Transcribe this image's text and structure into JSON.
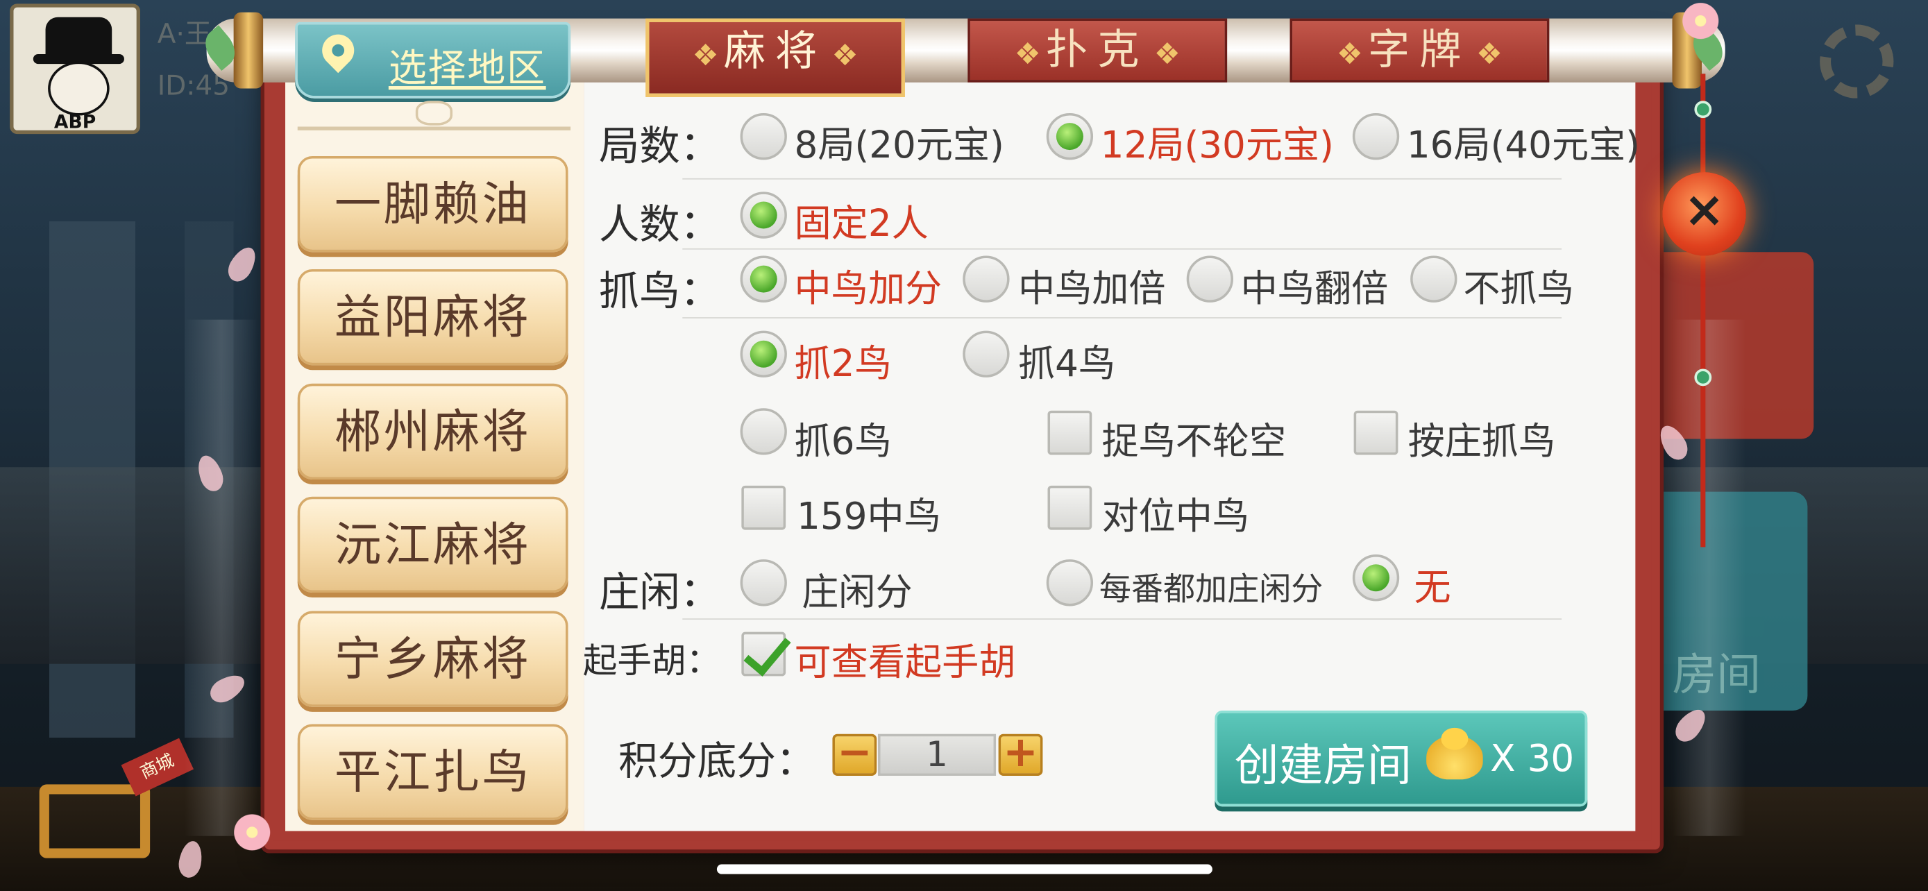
{
  "user": {
    "name": "A·王",
    "id": "ID:45"
  },
  "avatar_label": "ABP",
  "region_button": "选择地区",
  "tabs": [
    {
      "label": "麻将",
      "active": true
    },
    {
      "label": "扑克",
      "active": false
    },
    {
      "label": "字牌",
      "active": false
    }
  ],
  "game_list": [
    "一脚赖油",
    "益阳麻将",
    "郴州麻将",
    "沅江麻将",
    "宁乡麻将",
    "平江扎鸟"
  ],
  "rounds": {
    "label": "局数：",
    "options": [
      {
        "text": "8局(20元宝)",
        "selected": false
      },
      {
        "text": "12局(30元宝)",
        "selected": true
      },
      {
        "text": "16局(40元宝)",
        "selected": false
      }
    ]
  },
  "players": {
    "label": "人数：",
    "options": [
      {
        "text": "固定2人",
        "selected": true
      }
    ]
  },
  "catch_bird": {
    "label": "抓鸟：",
    "modes": [
      {
        "text": "中鸟加分",
        "selected": true
      },
      {
        "text": "中鸟加倍",
        "selected": false
      },
      {
        "text": "中鸟翻倍",
        "selected": false
      },
      {
        "text": "不抓鸟",
        "selected": false
      }
    ],
    "counts": [
      {
        "text": "抓2鸟",
        "selected": true
      },
      {
        "text": "抓4鸟",
        "selected": false
      },
      {
        "text": "抓6鸟",
        "selected": false
      }
    ],
    "checks": [
      {
        "text": "捉鸟不轮空",
        "checked": false
      },
      {
        "text": "按庄抓鸟",
        "checked": false
      },
      {
        "text": "159中鸟",
        "checked": false
      },
      {
        "text": "对位中鸟",
        "checked": false
      }
    ]
  },
  "banker": {
    "label": "庄闲：",
    "options": [
      {
        "text": "庄闲分",
        "selected": false
      },
      {
        "text": "每番都加庄闲分",
        "selected": false
      },
      {
        "text": "无",
        "selected": true
      }
    ]
  },
  "start_hu": {
    "label": "起手胡：",
    "option": {
      "text": "可查看起手胡",
      "checked": true
    }
  },
  "base_score": {
    "label": "积分底分：",
    "value": "1",
    "minus": "−",
    "plus": "+"
  },
  "create": {
    "label": "创建房间",
    "cost": "X 30"
  },
  "close": "×",
  "shop_tag": "商城",
  "bg_room_text": "房间",
  "colors": {
    "frame": "#a93b33",
    "selected_text": "#d23a22",
    "create_btn": "#3aaea1",
    "region_btn": "#5aaeb3"
  }
}
